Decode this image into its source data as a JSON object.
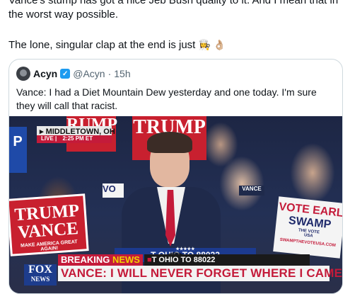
{
  "post": {
    "line1": "Vance's stump has got a nice Jeb Bush quality to it. And I mean that in",
    "line2": "the worst way possible.",
    "line3": "The lone, singular clap at the end is just",
    "emoji": "👩‍🍳 👌🏼"
  },
  "quoted": {
    "name": "Acyn",
    "handle": "@Acyn",
    "dot": "·",
    "time": "15h",
    "text": "Vance: I had a Diet Mountain Dew yesterday and one today. I'm sure they will call that racist."
  },
  "video": {
    "location": "MIDDLETOWN, OH",
    "live": "LIVE",
    "live_time": "2:25 PM ET",
    "sign_trump": "TRUMP",
    "sign_vance_partial": "VANCE",
    "sign_left_partial": "RUMP",
    "sign_blue_partial": "P",
    "sign_vo": "VO",
    "sign_vance_small": "VANCE",
    "sign_big_trump": "TRUMP",
    "sign_big_vance": "VANCE",
    "sign_big_sub": "MAKE AMERICA GREAT AGAIN!",
    "sign_vote_earl": "VOTE EARL",
    "sign_swamp": "SWAMP",
    "sign_the_vote": "THE VOTE",
    "sign_usa": "USA",
    "sign_url": "SWAMPTHEVOTEUSA.COM",
    "podium": "T OHIO TO 88022",
    "breaking": "BREAKING",
    "news": "NEWS",
    "ticker": "T OHIO TO 88022",
    "headline": "VANCE: I WILL NEVER FORGET WHERE I CAME FROM",
    "network": "FOX",
    "network_sub": "NEWS"
  },
  "colors": {
    "verified": "#1d9bf0",
    "breaking_red": "#c41b3a",
    "fox_blue": "#1d3c8c"
  }
}
